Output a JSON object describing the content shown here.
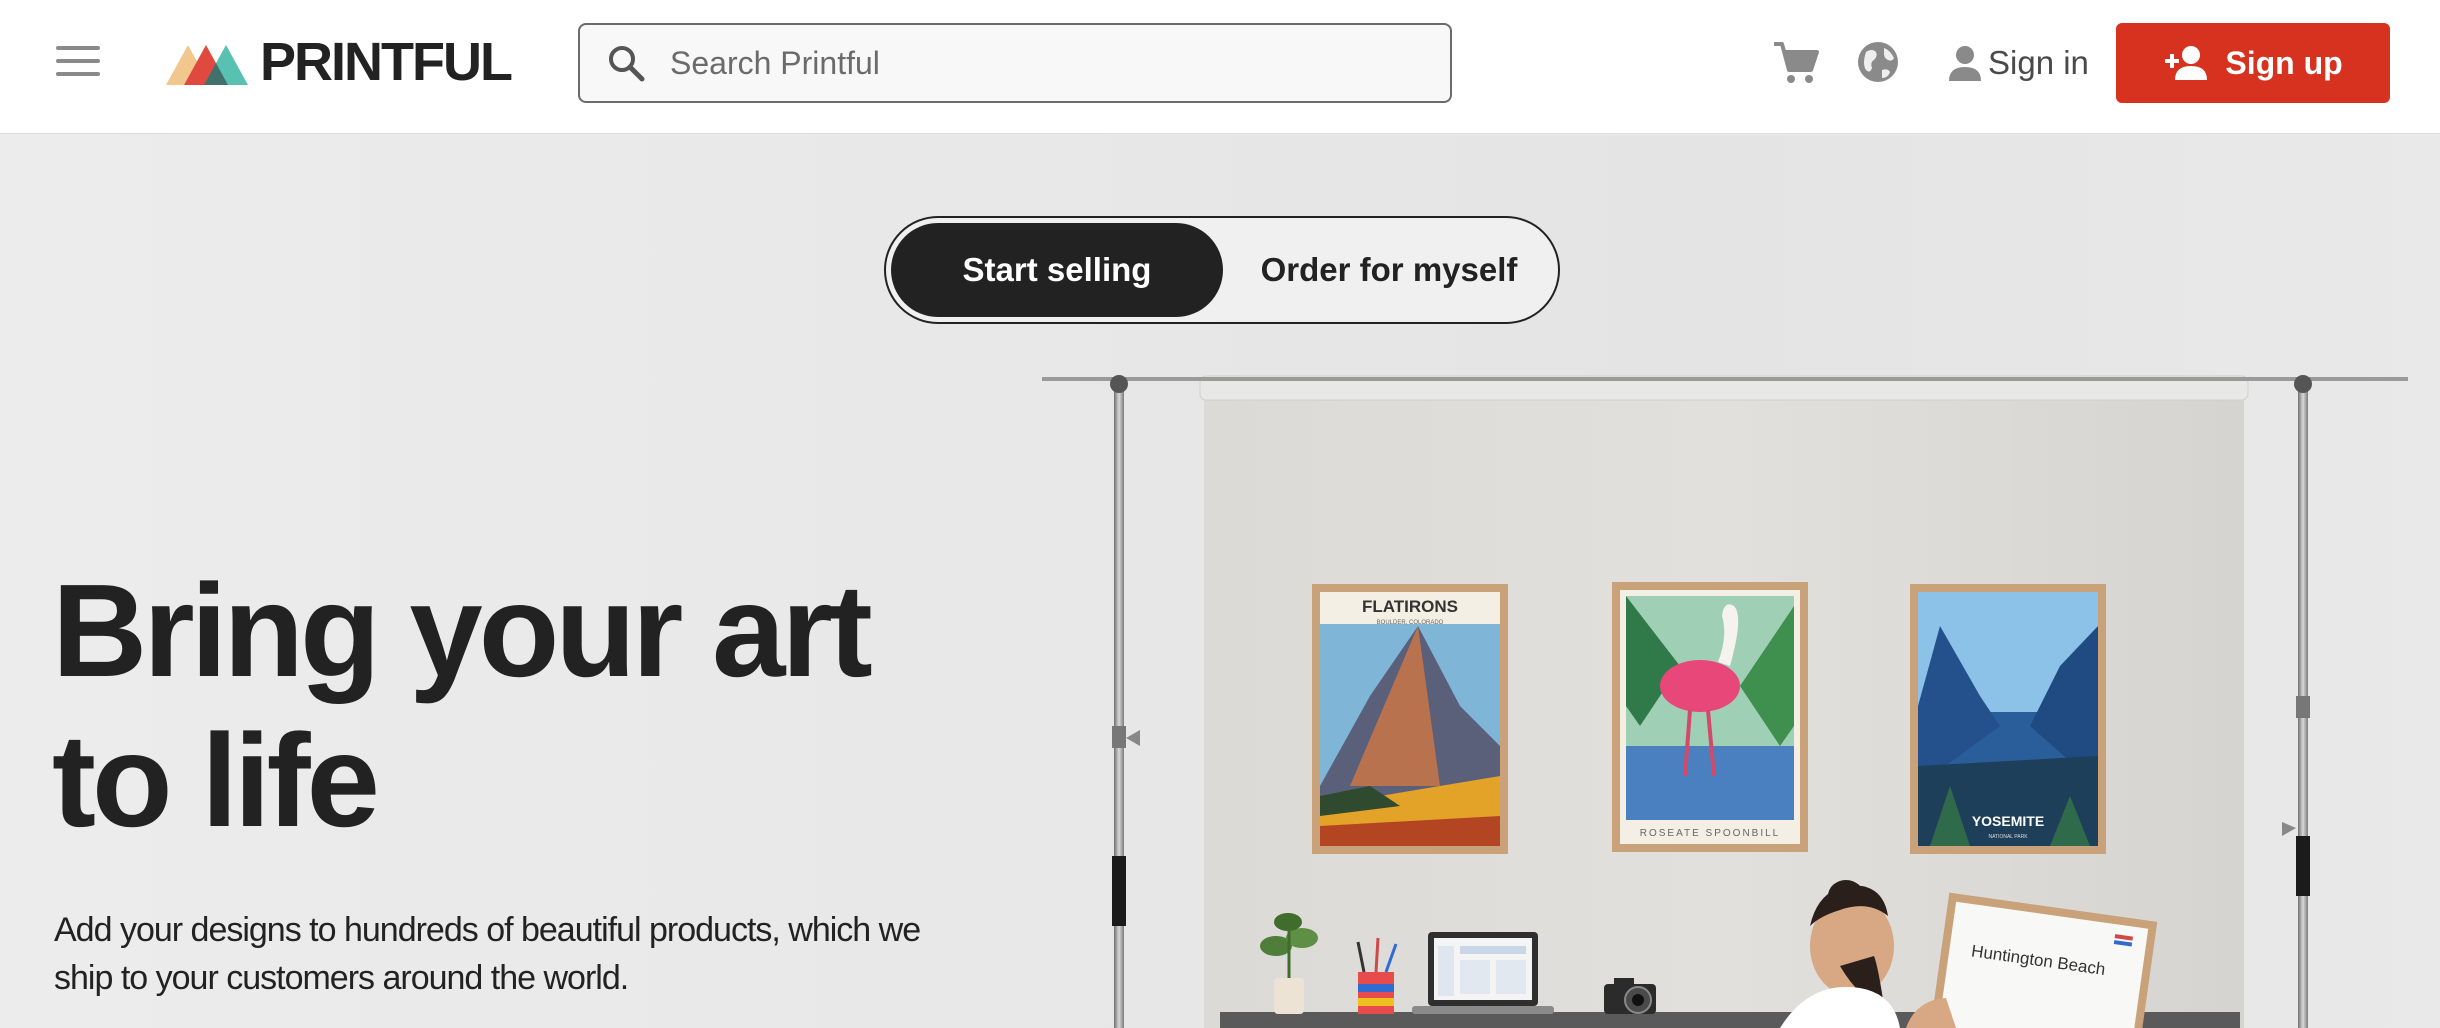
{
  "header": {
    "logo_text": "PRINTFUL",
    "search_placeholder": "Search Printful",
    "signin_label": "Sign in",
    "signup_label": "Sign up",
    "icons": [
      "menu-icon",
      "search-icon",
      "cart-icon",
      "globe-icon",
      "user-icon",
      "add-user-icon"
    ]
  },
  "toggle": {
    "options": [
      "Start selling",
      "Order for myself"
    ],
    "selected": "Start selling"
  },
  "hero": {
    "title_line1": "Bring your art",
    "title_line2": "to life",
    "subtitle": "Add your designs to hundreds of beautiful products, which we ship to your customers around the world."
  },
  "posters": [
    {
      "title": "FLATIRONS",
      "subtitle": "BOULDER, COLORADO"
    },
    {
      "title": "ROSEATE SPOONBILL",
      "subtitle": ""
    },
    {
      "title": "YOSEMITE",
      "subtitle": "NATIONAL PARK"
    }
  ],
  "held_poster_text": "Huntington Beach",
  "colors": {
    "brand_red": "#d7311f",
    "dark": "#222222",
    "header_bg": "#ffffff",
    "hero_bg": "#ebebeb"
  }
}
